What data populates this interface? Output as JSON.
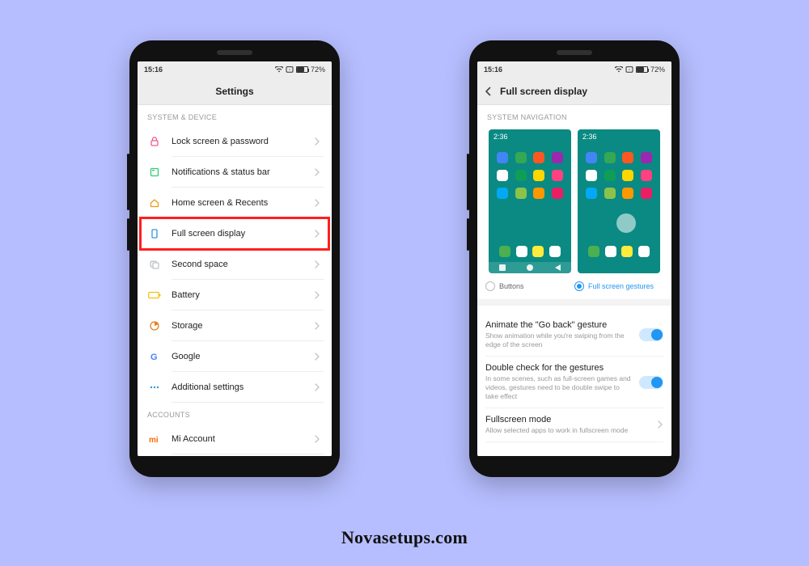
{
  "brand_footer": "Novasetups.com",
  "status": {
    "time": "15:16",
    "battery_pct": "72%"
  },
  "phone_settings": {
    "title": "Settings",
    "sections": [
      {
        "label": "SYSTEM & DEVICE",
        "items": [
          {
            "icon": "lock-icon",
            "color": "#ef5b8c",
            "label": "Lock screen & password"
          },
          {
            "icon": "notification-icon",
            "color": "#2ecc71",
            "label": "Notifications & status bar"
          },
          {
            "icon": "home-icon",
            "color": "#f39c12",
            "label": "Home screen & Recents"
          },
          {
            "icon": "fullscreen-icon",
            "color": "#3498db",
            "label": "Full screen display",
            "highlight": true
          },
          {
            "icon": "second-space-icon",
            "color": "#bdc3c7",
            "label": "Second space"
          },
          {
            "icon": "battery-icon",
            "color": "#f1c40f",
            "label": "Battery"
          },
          {
            "icon": "storage-icon",
            "color": "#e67e22",
            "label": "Storage"
          },
          {
            "icon": "google-icon",
            "color": "#4285f4",
            "label": "Google"
          },
          {
            "icon": "more-icon",
            "color": "#3498db",
            "label": "Additional settings"
          }
        ]
      },
      {
        "label": "ACCOUNTS",
        "items": [
          {
            "icon": "mi-icon",
            "color": "#ff6a00",
            "label": "Mi Account"
          }
        ]
      }
    ]
  },
  "phone_fsd": {
    "title": "Full screen display",
    "section_label": "SYSTEM NAVIGATION",
    "preview_time": "2:36",
    "radios": {
      "left": "Buttons",
      "right": "Full screen gestures",
      "selected": "right"
    },
    "options": [
      {
        "title": "Animate the \"Go back\" gesture",
        "sub": "Show animation while you're swiping from the edge of the screen",
        "toggle": true
      },
      {
        "title": "Double check for the gestures",
        "sub": "In some scenes, such as full-screen games and videos, gestures need to be double swipe to take effect",
        "toggle": true
      },
      {
        "title": "Fullscreen mode",
        "sub": "Allow selected apps to work in fullscreen mode",
        "chevron": true
      }
    ]
  }
}
